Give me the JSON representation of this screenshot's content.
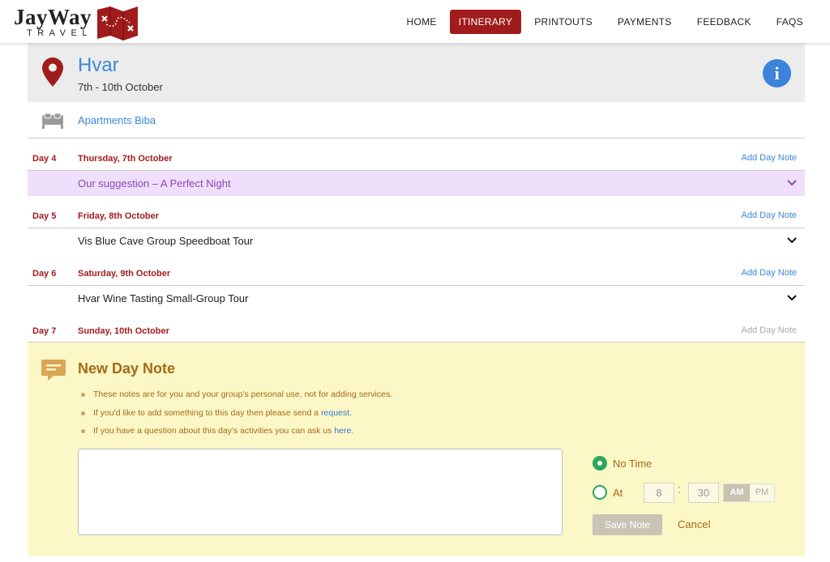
{
  "brand": {
    "name": "JayWay",
    "subname": "TRAVEL"
  },
  "nav": [
    {
      "label": "HOME",
      "active": false
    },
    {
      "label": "ITINERARY",
      "active": true
    },
    {
      "label": "PRINTOUTS",
      "active": false
    },
    {
      "label": "PAYMENTS",
      "active": false
    },
    {
      "label": "FEEDBACK",
      "active": false
    },
    {
      "label": "FAQS",
      "active": false
    }
  ],
  "destination": {
    "name": "Hvar",
    "dates": "7th - 10th October",
    "info_icon": "i"
  },
  "accommodation": {
    "name": "Apartments Biba"
  },
  "days": [
    {
      "num": "Day 4",
      "date": "Thursday, 7th October",
      "add_note": "Add Day Note",
      "item": "Our suggestion  – A Perfect Night"
    },
    {
      "num": "Day 5",
      "date": "Friday, 8th October",
      "add_note": "Add Day Note",
      "item": "Vis Blue Cave Group Speedboat Tour"
    },
    {
      "num": "Day 6",
      "date": "Saturday, 9th October",
      "add_note": "Add Day Note",
      "item": "Hvar Wine Tasting Small-Group Tour"
    },
    {
      "num": "Day 7",
      "date": "Sunday, 10th October",
      "add_note": "Add Day Note"
    }
  ],
  "note_panel": {
    "title": "New Day Note",
    "bullet1": "These notes are for you and your group's personal use, not for adding services.",
    "bullet2_pre": "If you'd like to add something to this day then please send a ",
    "bullet2_link": "request.",
    "bullet3_pre": "If you have a question about this day's activities you can ask us ",
    "bullet3_link": "here.",
    "textarea_value": "",
    "no_time_label": "No Time",
    "at_label": "At",
    "hour": "8",
    "minute": "30",
    "colon": ":",
    "am": "AM",
    "pm": "PM",
    "save_label": "Save Note",
    "cancel_label": "Cancel"
  },
  "colors": {
    "brand_red": "#a01c1c",
    "link_blue": "#3b87d9",
    "note_bg": "#fcf7c6",
    "suggest_bg": "#efdffb",
    "radio_green": "#2aa85a"
  }
}
